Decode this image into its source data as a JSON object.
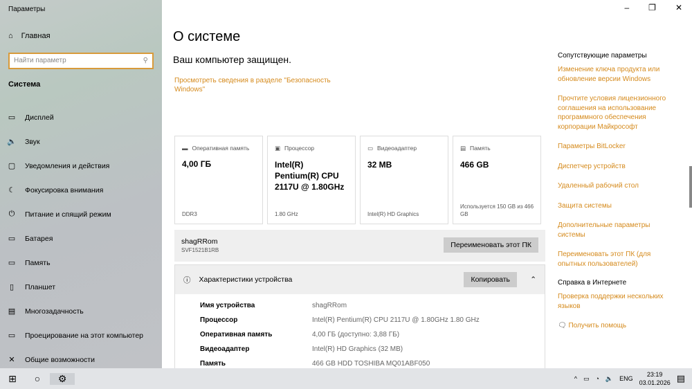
{
  "window": {
    "title": "Параметры"
  },
  "sidebar": {
    "home": "Главная",
    "search_placeholder": "Найти параметр",
    "section": "Система",
    "items": [
      {
        "label": "Дисплей",
        "icon": "▭"
      },
      {
        "label": "Звук",
        "icon": "🔈"
      },
      {
        "label": "Уведомления и действия",
        "icon": "▢"
      },
      {
        "label": "Фокусировка внимания",
        "icon": "☾"
      },
      {
        "label": "Питание и спящий режим",
        "icon": "⏻"
      },
      {
        "label": "Батарея",
        "icon": "▭"
      },
      {
        "label": "Память",
        "icon": "▭"
      },
      {
        "label": "Планшет",
        "icon": "▯"
      },
      {
        "label": "Многозадачность",
        "icon": "▤"
      },
      {
        "label": "Проецирование на этот компьютер",
        "icon": "▭"
      },
      {
        "label": "Общие возможности",
        "icon": "✕"
      }
    ]
  },
  "main": {
    "title": "О системе",
    "protected": "Ваш компьютер защищен.",
    "security_link": "Просмотреть сведения в разделе \"Безопасность Windows\"",
    "cards": [
      {
        "label": "Оперативная память",
        "value": "4,00 ГБ",
        "sub": "DDR3",
        "icon": "▬"
      },
      {
        "label": "Процессор",
        "value": "Intel(R) Pentium(R) CPU 2117U @ 1.80GHz",
        "sub": "1.80 GHz",
        "icon": "▣"
      },
      {
        "label": "Видеоадаптер",
        "value": "32 MB",
        "sub": "Intel(R) HD Graphics",
        "icon": "▭"
      },
      {
        "label": "Память",
        "value": "466 GB",
        "sub": "Используется 150 GB из 466 GB",
        "icon": "▤"
      }
    ],
    "pc_name": "shagRRom",
    "pc_model": "SVF1521B1RB",
    "rename_button": "Переименовать этот ПК",
    "specs_title": "Характеристики устройства",
    "copy_button": "Копировать",
    "specs": [
      {
        "k": "Имя устройства",
        "v": "shagRRom"
      },
      {
        "k": "Процессор",
        "v": "Intel(R) Pentium(R) CPU 2117U @ 1.80GHz   1.80 GHz"
      },
      {
        "k": "Оперативная память",
        "v": "4,00 ГБ (доступно: 3,88 ГБ)"
      },
      {
        "k": "Видеоадаптер",
        "v": "Intel(R) HD Graphics (32 MB)"
      },
      {
        "k": "Память",
        "v": "466 GB HDD TOSHIBA MQ01ABF050"
      }
    ]
  },
  "related": {
    "heading": "Сопутствующие параметры",
    "links": [
      "Изменение ключа продукта или обновление версии Windows",
      "Прочтите условия лицензионного соглашения на использование программного обеспечения корпорации Майкрософт",
      "Параметры BitLocker",
      "Диспетчер устройств",
      "Удаленный рабочий стол",
      "Защита системы",
      "Дополнительные параметры системы",
      "Переименовать этот ПК (для опытных пользователей)"
    ],
    "help_heading": "Справка в Интернете",
    "help_links": [
      "Проверка поддержки нескольких языков"
    ],
    "get_help": "Получить помощь"
  },
  "taskbar": {
    "lang": "ENG",
    "time": "23:19",
    "date": "03.01.2026"
  }
}
